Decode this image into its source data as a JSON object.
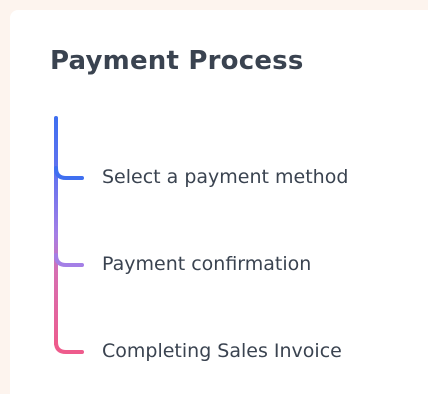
{
  "card": {
    "title": "Payment Process"
  },
  "steps": [
    {
      "label": "Select a payment method",
      "color": "#3f6ff0"
    },
    {
      "label": "Payment confirmation",
      "color": "#a47fe6"
    },
    {
      "label": "Completing Sales Invoice",
      "color": "#ee5b8c"
    }
  ],
  "colors": {
    "page_background": "#fdf4ee",
    "card_background": "#ffffff",
    "text": "#3a4350"
  }
}
